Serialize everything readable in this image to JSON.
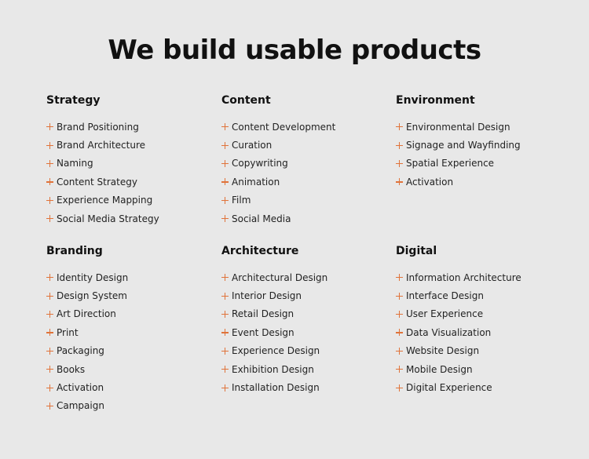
{
  "headline": "We build usable products",
  "sections": [
    {
      "title": "Strategy",
      "items": [
        "Brand Positioning",
        "Brand Architecture",
        "Naming",
        "Content Strategy",
        "Experience Mapping",
        "Social Media Strategy"
      ]
    },
    {
      "title": "Content",
      "items": [
        "Content Development",
        "Curation",
        "Copywriting",
        "Animation",
        "Film",
        "Social Media"
      ]
    },
    {
      "title": "Environment",
      "items": [
        "Environmental Design",
        "Signage and Wayfinding",
        "Spatial Experience",
        "Activation"
      ]
    },
    {
      "title": "Branding",
      "items": [
        "Identity Design",
        "Design System",
        "Art Direction",
        "Print",
        "Packaging",
        "Books",
        "Activation",
        "Campaign"
      ]
    },
    {
      "title": "Architecture",
      "items": [
        "Architectural Design",
        "Interior Design",
        "Retail Design",
        "Event Design",
        "Experience Design",
        "Exhibition Design",
        "Installation Design"
      ]
    },
    {
      "title": "Digital",
      "items": [
        "Information Architecture",
        "Interface Design",
        "User Experience",
        "Data Visualization",
        "Website Design",
        "Mobile Design",
        "Digital Experience"
      ]
    }
  ],
  "icon": "plus-icon",
  "colors": {
    "background": "#e8e8e8",
    "accent": "#e0733a",
    "text": "#222222",
    "heading": "#111111"
  }
}
